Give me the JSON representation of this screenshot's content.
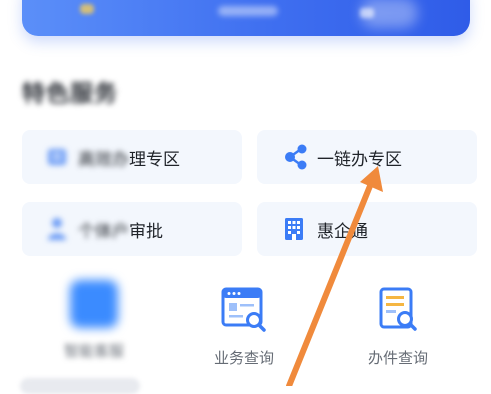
{
  "section": {
    "title": "特色服务"
  },
  "grid": {
    "items": [
      {
        "label_blurred": "高效办",
        "label_visible": "理专区",
        "icon": "building-blurred-icon"
      },
      {
        "label": "一链办专区",
        "icon": "share-nodes-icon"
      },
      {
        "label_blurred": "个体户",
        "label_visible": "审批",
        "icon": "person-blurred-icon"
      },
      {
        "label": "惠企通",
        "icon": "office-building-icon"
      }
    ]
  },
  "bottom": {
    "items": [
      {
        "label": "智能客服",
        "icon": "blurred-app-icon"
      },
      {
        "label": "业务查询",
        "icon": "browser-search-icon"
      },
      {
        "label": "办件查询",
        "icon": "document-search-icon"
      }
    ]
  },
  "colors": {
    "primary": "#3b7cf6",
    "card_bg": "#f3f7fd",
    "arrow": "#f08a3c"
  }
}
